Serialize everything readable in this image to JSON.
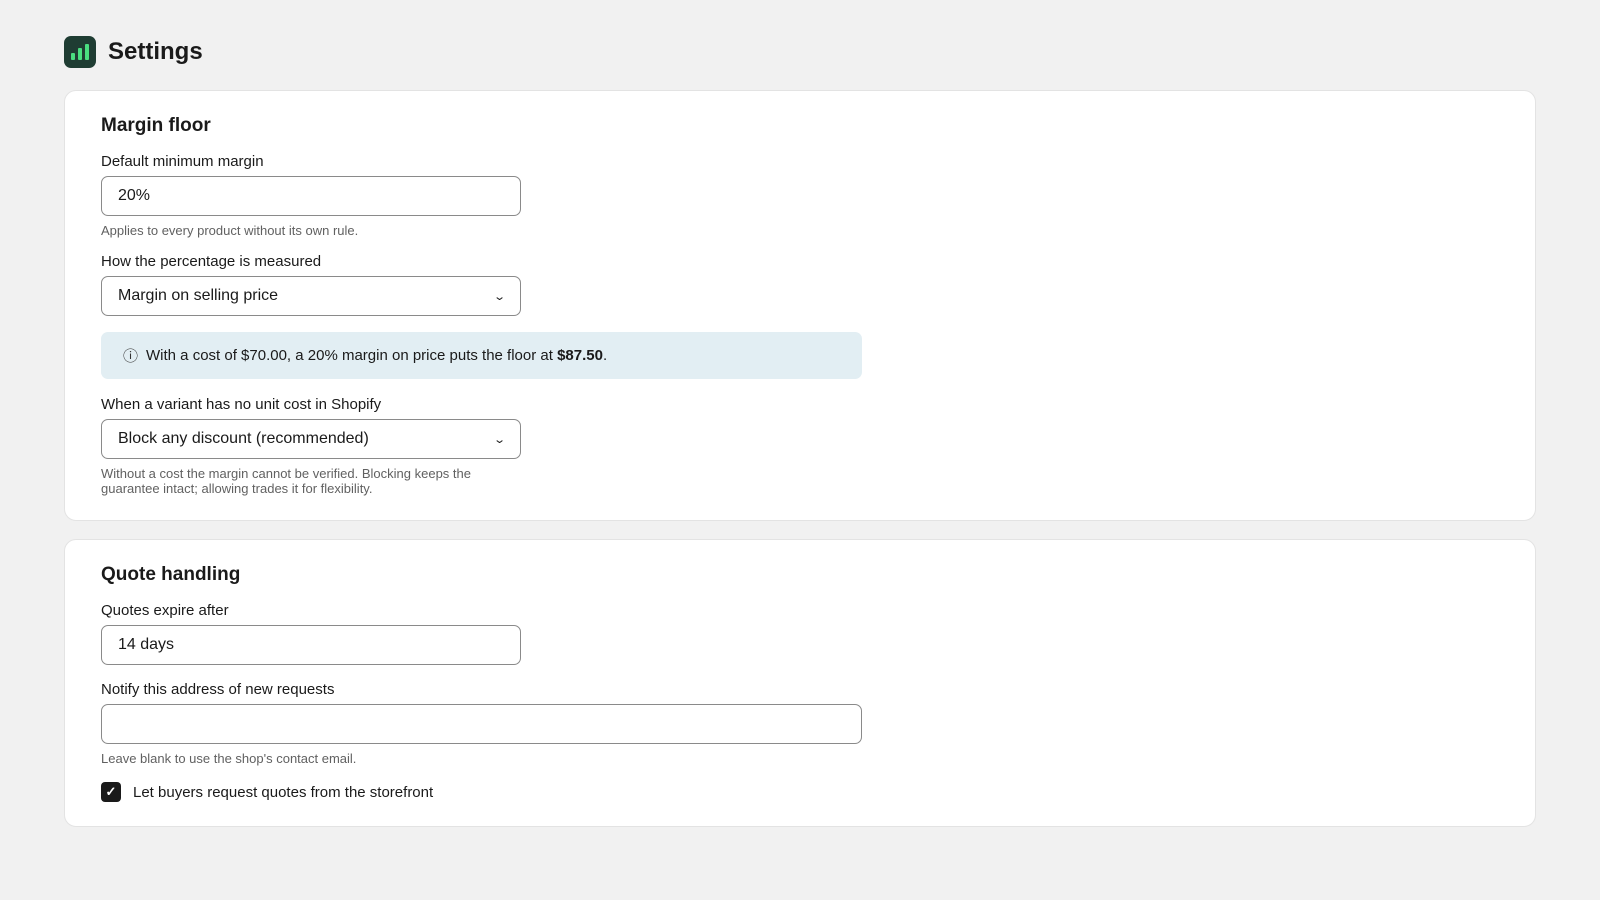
{
  "header": {
    "title": "Settings",
    "logo_icon": "bar-chart-icon"
  },
  "margin_floor": {
    "title": "Margin floor",
    "default_margin": {
      "label": "Default minimum margin",
      "value": "20%",
      "help": "Applies to every product without its own rule."
    },
    "measure": {
      "label": "How the percentage is measured",
      "selected": "Margin on selling price"
    },
    "info": {
      "prefix": "With a cost of $70.00, a 20% margin on price puts the floor at ",
      "amount": "$87.50",
      "suffix": "."
    },
    "no_cost": {
      "label": "When a variant has no unit cost in Shopify",
      "selected": "Block any discount (recommended)",
      "help": "Without a cost the margin cannot be verified. Blocking keeps the guarantee intact; allowing trades it for flexibility."
    }
  },
  "quote_handling": {
    "title": "Quote handling",
    "expire": {
      "label": "Quotes expire after",
      "value": "14 days"
    },
    "notify": {
      "label": "Notify this address of new requests",
      "value": "",
      "help": "Leave blank to use the shop's contact email."
    },
    "storefront_checkbox": {
      "label": "Let buyers request quotes from the storefront",
      "checked": true
    }
  },
  "colors": {
    "logo_bg": "#1f3d33",
    "logo_bars": "#4ade80",
    "info_bg": "#e2eef3",
    "page_bg": "#f1f1f1"
  }
}
